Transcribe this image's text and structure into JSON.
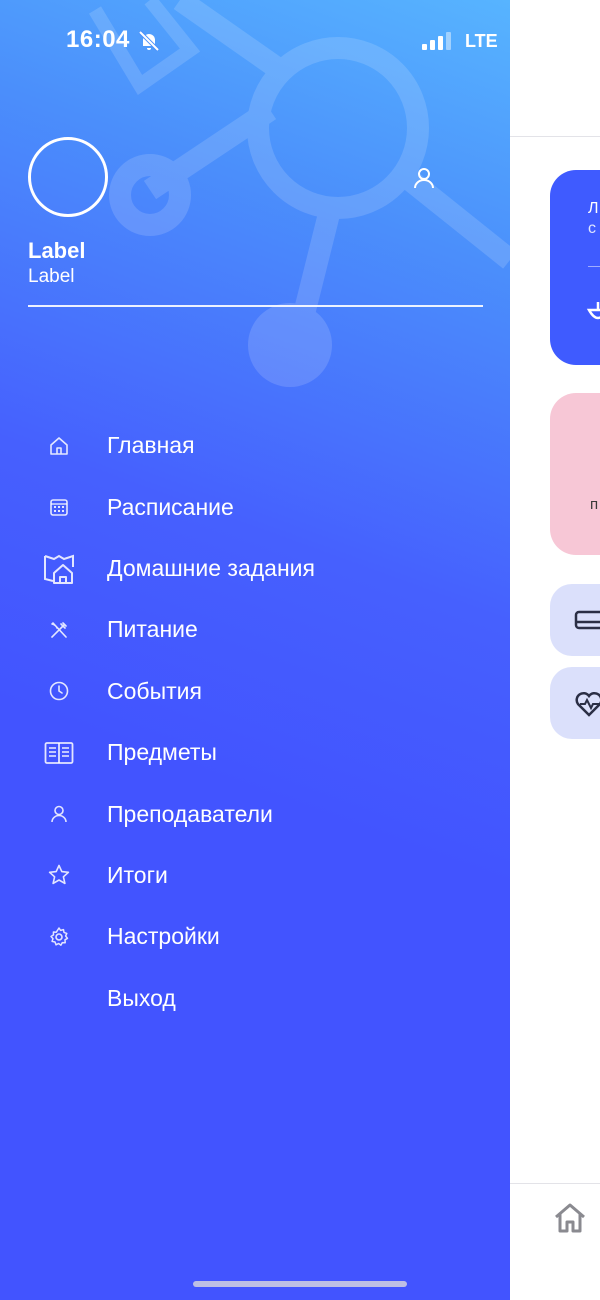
{
  "status_bar": {
    "time": "16:04",
    "network": "LTE"
  },
  "profile": {
    "name": "Label",
    "subtitle": "Label"
  },
  "menu": [
    {
      "label": "Главная",
      "icon": "home-icon"
    },
    {
      "label": "Расписание",
      "icon": "calendar-icon"
    },
    {
      "label": "Домашние задания",
      "icon": "homework-icon"
    },
    {
      "label": "Питание",
      "icon": "utensils-icon"
    },
    {
      "label": "События",
      "icon": "clock-icon"
    },
    {
      "label": "Предметы",
      "icon": "book-icon"
    },
    {
      "label": "Преподаватели",
      "icon": "person-icon"
    },
    {
      "label": "Итоги",
      "icon": "star-icon"
    },
    {
      "label": "Настройки",
      "icon": "gear-icon"
    },
    {
      "label": "Выход",
      "icon": ""
    }
  ],
  "background_app": {
    "card1_line1": "Л",
    "card1_line2": "с",
    "card2_text": "п"
  },
  "colors": {
    "drawer_top": "#57b4ff",
    "drawer_main": "#4254ff",
    "accent_pink": "#f7c7d6",
    "accent_lavender": "#dbe0fb"
  }
}
